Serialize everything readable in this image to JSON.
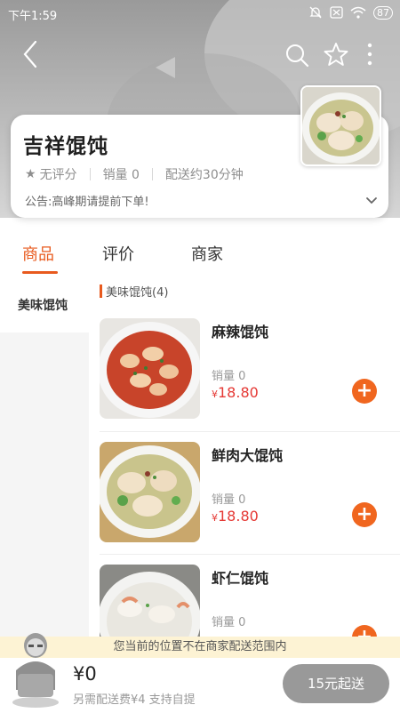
{
  "status_bar": {
    "time": "下午1:59",
    "battery": "87"
  },
  "nav": {
    "back_icon": "chevron-left-icon",
    "search_icon": "search-icon",
    "favorite_icon": "star-outline-icon",
    "more_icon": "more-vertical-icon"
  },
  "shop": {
    "name": "吉祥馄饨",
    "rating": "无评分",
    "sales": "销量 0",
    "delivery": "配送约30分钟",
    "notice": "公告:高峰期请提前下单!"
  },
  "tabs": [
    {
      "label": "商品",
      "active": true
    },
    {
      "label": "评价",
      "active": false
    },
    {
      "label": "商家",
      "active": false
    }
  ],
  "categories": [
    {
      "label": "美味馄饨",
      "selected": true
    }
  ],
  "section": {
    "title": "美味馄饨(4)"
  },
  "products": [
    {
      "name": "麻辣馄饨",
      "sales": "销量 0",
      "currency": "¥",
      "price": "18.80"
    },
    {
      "name": "鲜肉大馄饨",
      "sales": "销量 0",
      "currency": "¥",
      "price": "18.80"
    },
    {
      "name": "虾仁馄饨",
      "sales": "销量 0",
      "currency": "¥",
      "price": ""
    }
  ],
  "warning": "您当前的位置不在商家配送范围内",
  "cart": {
    "total": "¥0",
    "subtitle": "另需配送费¥4  支持自提",
    "checkout_label": "15元起送"
  },
  "colors": {
    "accent": "#e85a1e",
    "price": "#e53935",
    "add_button": "#f0661f",
    "disabled": "#999999"
  }
}
